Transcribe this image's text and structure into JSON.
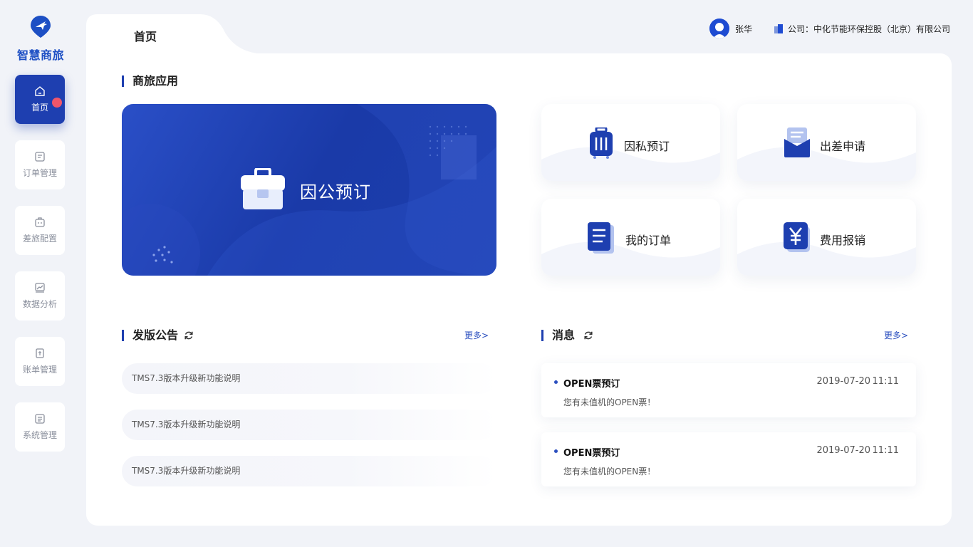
{
  "brand": {
    "name": "智慧商旅",
    "color": "#1d4fc4"
  },
  "sidebar": {
    "items": [
      {
        "label": "首页",
        "icon": "home-icon",
        "active": true
      },
      {
        "label": "订单管理",
        "icon": "order-icon"
      },
      {
        "label": "差旅配置",
        "icon": "briefcase-icon"
      },
      {
        "label": "数据分析",
        "icon": "chart-icon"
      },
      {
        "label": "账单管理",
        "icon": "bill-icon"
      },
      {
        "label": "系统管理",
        "icon": "system-icon"
      }
    ]
  },
  "tab": {
    "title": "首页"
  },
  "header": {
    "user_name": "张华",
    "company": "公司：中化节能环保控股（北京）有限公司"
  },
  "apps": {
    "title": "商旅应用",
    "hero_label": "因公预订",
    "tiles": [
      {
        "label": "因私预订",
        "icon": "luggage-icon"
      },
      {
        "label": "出差申请",
        "icon": "envelope-icon"
      },
      {
        "label": "我的订单",
        "icon": "document-icon"
      },
      {
        "label": "费用报销",
        "icon": "yuan-icon"
      }
    ]
  },
  "notices": {
    "title": "发版公告",
    "more": "更多>",
    "items": [
      "TMS7.3版本升级新功能说明",
      "TMS7.3版本升级新功能说明",
      "TMS7.3版本升级新功能说明"
    ]
  },
  "messages": {
    "title": "消息",
    "more": "更多>",
    "items": [
      {
        "title": "OPEN票预订",
        "date": "2019-07-20",
        "time": "11:11",
        "body": "您有未值机的OPEN票！"
      },
      {
        "title": "OPEN票预订",
        "date": "2019-07-20",
        "time": "11:11",
        "body": "您有未值机的OPEN票！"
      }
    ]
  },
  "colors": {
    "accent": "#1e3fb0",
    "badge": "#f0566a",
    "link": "#2b4fbf"
  }
}
